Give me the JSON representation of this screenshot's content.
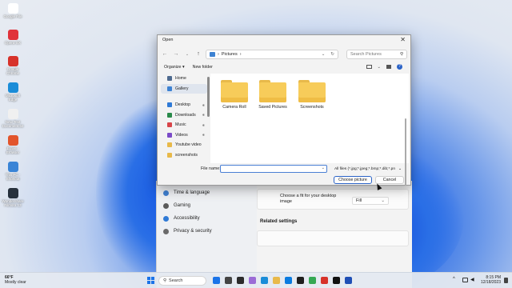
{
  "desktop": {
    "icons": [
      {
        "label": "Google File",
        "color": "#ffffff"
      },
      {
        "label": "Opera GX",
        "color": "#e0333b"
      },
      {
        "label": "Google Chrome",
        "color": "#d7322a"
      },
      {
        "label": "Microsoft Edge",
        "color": "#1a8cd8"
      },
      {
        "label": "New Text Document.txt",
        "color": "#f0f0f0"
      },
      {
        "label": "Brave - Browser",
        "color": "#e2552c"
      },
      {
        "label": "This PC - Shortcut",
        "color": "#3a84d6"
      },
      {
        "label": "Wondershare Filmora 13",
        "color": "#27313d"
      }
    ]
  },
  "dialog": {
    "title": "Open",
    "close_glyph": "✕",
    "address": {
      "root": "Pictures",
      "sep1": "›",
      "sep2": "›"
    },
    "search_placeholder": "Search Pictures",
    "toolbar": {
      "organize": "Organize ▾",
      "new_folder": "New folder"
    },
    "sidebar": [
      {
        "label": "Home",
        "icon": "home-icon",
        "color": "#4e6a8f",
        "pinned": false,
        "selected": false
      },
      {
        "label": "Gallery",
        "icon": "gallery-icon",
        "color": "#3d82d2",
        "pinned": false,
        "selected": true
      },
      {
        "label": "Desktop",
        "icon": "desktop-icon",
        "color": "#2f7ad6",
        "pinned": true,
        "selected": false
      },
      {
        "label": "Downloads",
        "icon": "downloads-icon",
        "color": "#2a8a4a",
        "pinned": true,
        "selected": false
      },
      {
        "label": "Music",
        "icon": "music-icon",
        "color": "#d8454a",
        "pinned": true,
        "selected": false
      },
      {
        "label": "Videos",
        "icon": "videos-icon",
        "color": "#7b4bc8",
        "pinned": true,
        "selected": false
      },
      {
        "label": "Youtube video",
        "icon": "folder-icon",
        "color": "#e8b94a",
        "pinned": false,
        "selected": false
      },
      {
        "label": "screenshots",
        "icon": "folder-icon",
        "color": "#e8b94a",
        "pinned": false,
        "selected": false
      }
    ],
    "folders": [
      "Camera Roll",
      "Saved Pictures",
      "Screenshots"
    ],
    "file_name_label": "File name:",
    "file_name_value": "",
    "file_type": "All files (*.jpg;*.jpeg;*.bmp;*.dib;*.pn",
    "choose_button": "Choose picture",
    "cancel_button": "Cancel"
  },
  "settings": {
    "nav": [
      {
        "label": "Time & language",
        "color": "#3f7fd0"
      },
      {
        "label": "Gaming",
        "color": "#5a5a5a"
      },
      {
        "label": "Accessibility",
        "color": "#2f7ad6"
      },
      {
        "label": "Privacy & security",
        "color": "#6a6a6a"
      }
    ],
    "fit_text": "Choose a fit for your desktop image",
    "fit_value": "Fill",
    "related": "Related settings"
  },
  "taskbar": {
    "temp": "66°F",
    "weather": "Mostly clear",
    "search": "Search",
    "time": "8:15 PM",
    "date": "12/18/2023",
    "app_colors": [
      "#1a73e8",
      "#444",
      "#2b2b2b",
      "#9b6bd6",
      "#1a8cd8",
      "#e8b94a",
      "#0a7be0",
      "#1e1e1e",
      "#34a853",
      "#d7322a",
      "#111",
      "#1f4fb5"
    ]
  }
}
